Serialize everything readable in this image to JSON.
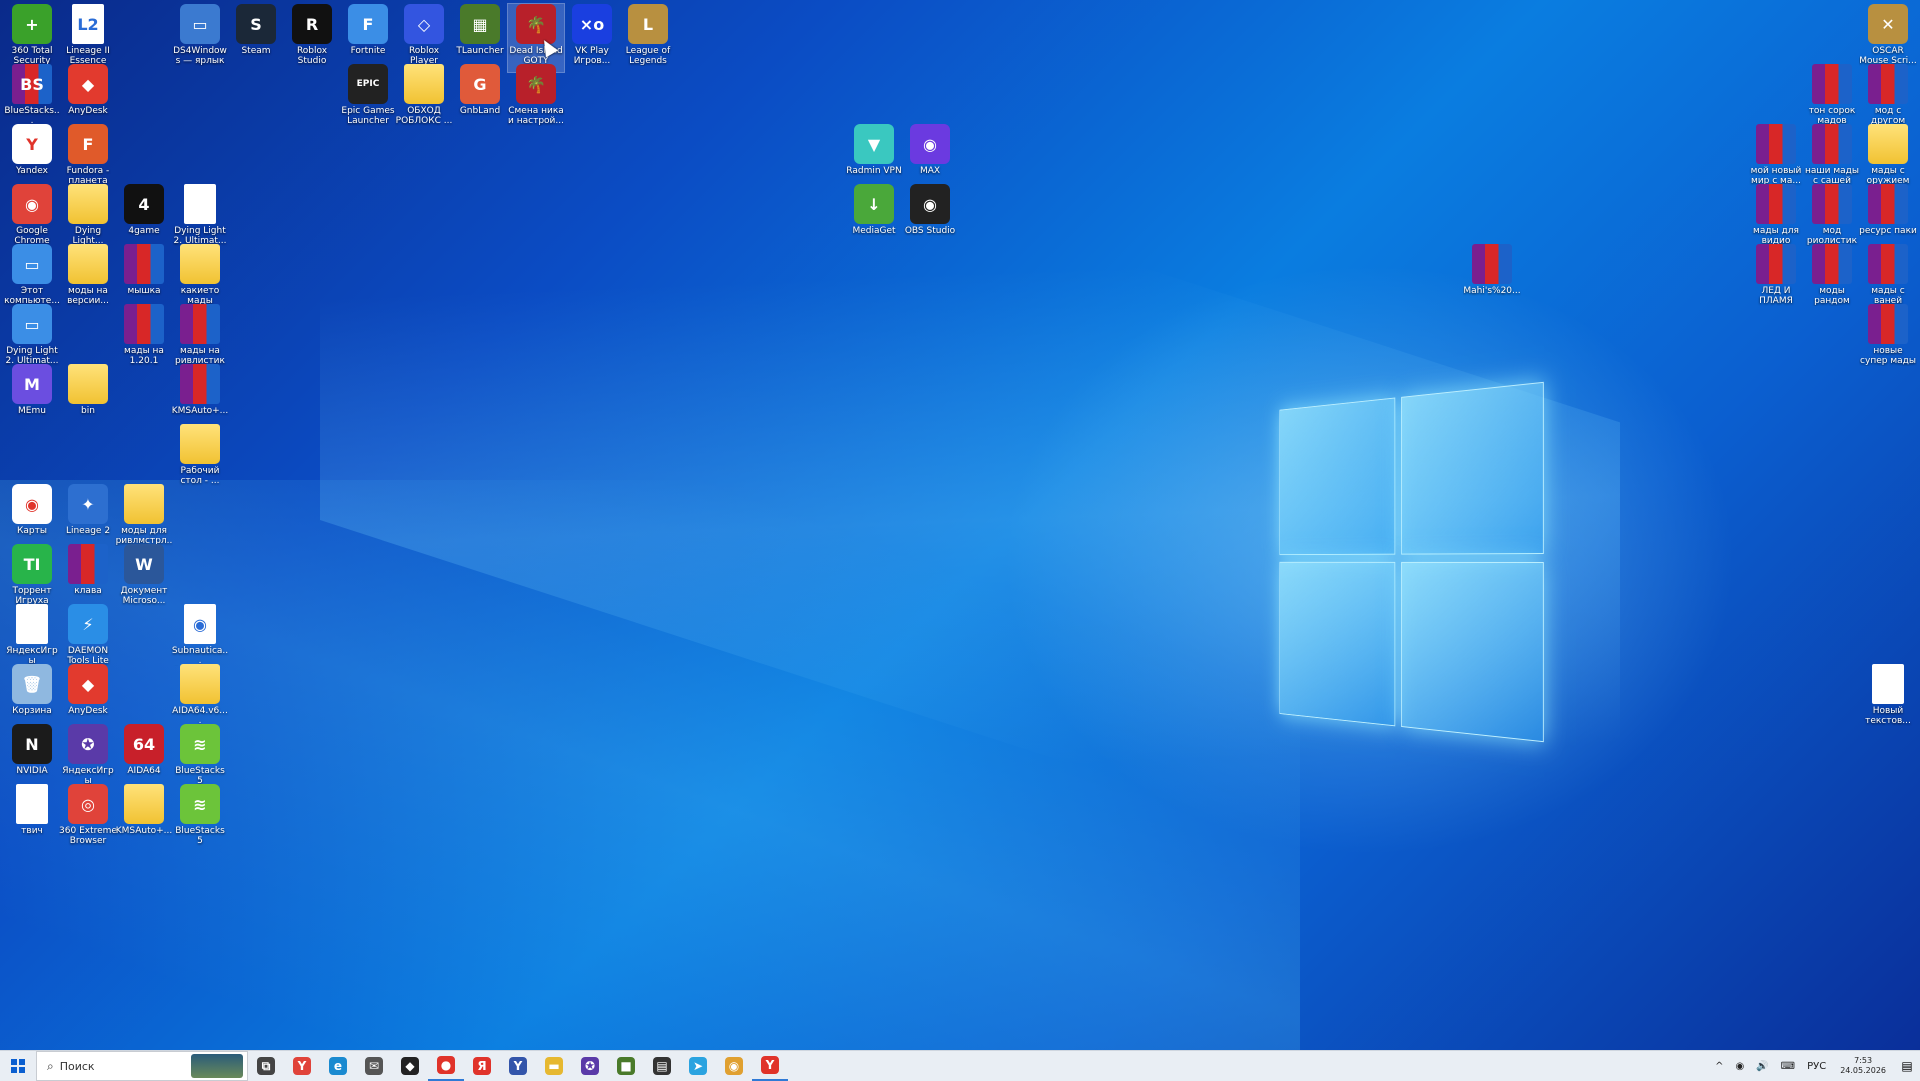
{
  "desktop": {
    "icons": [
      {
        "label": "360 Total Security",
        "glyph": "+",
        "color": "#3aa12a"
      },
      {
        "label": "Lineage II Essence",
        "glyph": "L2",
        "color": "#ffffff",
        "kind": "file"
      },
      {
        "label": "BlueStacks...",
        "glyph": "BS",
        "kind": "rar"
      },
      {
        "label": "AnyDesk",
        "glyph": "◆",
        "color": "#e23a2e"
      },
      {
        "label": "Yandex",
        "glyph": "Y",
        "color": "#ffffff"
      },
      {
        "label": "Fundora - планета игр",
        "glyph": "F",
        "color": "#e05a2a"
      },
      {
        "label": "Google Chrome",
        "glyph": "◉",
        "color": "#e0433a"
      },
      {
        "label": "Dying Light...",
        "glyph": "",
        "kind": "folder"
      },
      {
        "label": "4game",
        "glyph": "4",
        "color": "#111111"
      },
      {
        "label": "Dying Light 2. Ultimat...",
        "glyph": "",
        "kind": "file"
      },
      {
        "label": "Этот компьюте...",
        "glyph": "▭",
        "color": "#3b8ee6"
      },
      {
        "label": "моды на версии...",
        "glyph": "",
        "kind": "folder"
      },
      {
        "label": "мышка",
        "glyph": "",
        "kind": "rar"
      },
      {
        "label": "какието мады",
        "glyph": "",
        "kind": "folder"
      },
      {
        "label": "Dying Light 2. Ultimat...",
        "glyph": "▭",
        "color": "#3b8ee6"
      },
      {
        "label": "мады на 1.20.1",
        "glyph": "",
        "kind": "rar"
      },
      {
        "label": "мады на ривлистик",
        "glyph": "",
        "kind": "rar"
      },
      {
        "label": "MEmu",
        "glyph": "M",
        "color": "#6b4ee0"
      },
      {
        "label": "bin",
        "glyph": "",
        "kind": "folder"
      },
      {
        "label": "KMSAuto+...",
        "glyph": "",
        "kind": "rar"
      },
      {
        "label": "Рабочий стол - ...",
        "glyph": "",
        "kind": "folder"
      },
      {
        "label": "Карты",
        "glyph": "◉",
        "color": "#ffffff"
      },
      {
        "label": "Lineage 2",
        "glyph": "✦",
        "color": "#2d6fd0"
      },
      {
        "label": "моды для ривлмстрл...",
        "glyph": "",
        "kind": "folder"
      },
      {
        "label": "Торрент Игруха",
        "glyph": "TI",
        "color": "#28b44a"
      },
      {
        "label": "клава",
        "glyph": "",
        "kind": "rar"
      },
      {
        "label": "Документ Microso...",
        "glyph": "W",
        "color": "#2b579a"
      },
      {
        "label": "ЯндексИгры",
        "glyph": "",
        "kind": "file"
      },
      {
        "label": "DAEMON Tools Lite",
        "glyph": "⚡",
        "color": "#2a8ee6"
      },
      {
        "label": "Subnautica... AvailableT...",
        "glyph": "◉",
        "kind": "file"
      },
      {
        "label": "Корзина",
        "glyph": "🗑",
        "color": "#8fb8e0"
      },
      {
        "label": "AnyDesk",
        "glyph": "◆",
        "color": "#e23a2e"
      },
      {
        "label": "AIDA64.v6....",
        "glyph": "",
        "kind": "folder"
      },
      {
        "label": "NVIDIA",
        "glyph": "N",
        "color": "#1b1b1b"
      },
      {
        "label": "ЯндексИгры",
        "glyph": "✪",
        "color": "#5a3aa8"
      },
      {
        "label": "AIDA64",
        "glyph": "64",
        "color": "#c8202a"
      },
      {
        "label": "BlueStacks 5",
        "glyph": "≋",
        "color": "#6cc43a"
      },
      {
        "label": "твич",
        "glyph": "",
        "kind": "file"
      },
      {
        "label": "360 Extreme Browser",
        "glyph": "◎",
        "color": "#e0433a"
      },
      {
        "label": "KMSAuto+...",
        "glyph": "",
        "kind": "folder"
      },
      {
        "label": "BlueStacks 5",
        "glyph": "≋",
        "color": "#6cc43a"
      },
      {
        "label": "DS4Windows — ярлык",
        "glyph": "▭",
        "color": "#3b7ad0"
      },
      {
        "label": "Steam",
        "glyph": "S",
        "color": "#1b2838"
      },
      {
        "label": "Roblox Studio",
        "glyph": "R",
        "color": "#111111"
      },
      {
        "label": "Fortnite",
        "glyph": "F",
        "color": "#3b8ee6"
      },
      {
        "label": "Roblox Player",
        "glyph": "◇",
        "color": "#3355e0"
      },
      {
        "label": "TLauncher",
        "glyph": "▦",
        "color": "#4a7a2a"
      },
      {
        "label": "Dead Island GOTY",
        "glyph": "🌴",
        "color": "#b8202a"
      },
      {
        "label": "VK Play Игров...",
        "glyph": "×o",
        "color": "#1a3fe0"
      },
      {
        "label": "League of Legends",
        "glyph": "L",
        "color": "#b89040"
      },
      {
        "label": "Epic Games Launcher",
        "glyph": "EPIC",
        "color": "#222222"
      },
      {
        "label": "ОБХОД РОБЛОКС ...",
        "glyph": "",
        "kind": "folder"
      },
      {
        "label": "GnbLand",
        "glyph": "G",
        "color": "#e05a3a"
      },
      {
        "label": "Смена ника и настрой...",
        "glyph": "🌴",
        "color": "#b8202a"
      },
      {
        "label": "Radmin VPN",
        "glyph": "▼",
        "color": "#3ac8c0"
      },
      {
        "label": "MAX",
        "glyph": "◉",
        "color": "#6b3ae0"
      },
      {
        "label": "MediaGet",
        "glyph": "↓",
        "color": "#4aa83a"
      },
      {
        "label": "OBS Studio",
        "glyph": "◉",
        "color": "#222222"
      },
      {
        "label": "Mahi's%20...",
        "glyph": "",
        "kind": "rar"
      },
      {
        "label": "OSCAR Mouse Scri...",
        "glyph": "✕",
        "color": "#b89040"
      },
      {
        "label": "тон сорок мадов",
        "glyph": "",
        "kind": "rar"
      },
      {
        "label": "мод с другом",
        "glyph": "",
        "kind": "rar"
      },
      {
        "label": "мой новый мир с ма...",
        "glyph": "",
        "kind": "rar"
      },
      {
        "label": "наши мады с сашей",
        "glyph": "",
        "kind": "rar"
      },
      {
        "label": "мады с оружием",
        "glyph": "",
        "kind": "folder"
      },
      {
        "label": "мады для видио",
        "glyph": "",
        "kind": "rar"
      },
      {
        "label": "мод риолистик",
        "glyph": "",
        "kind": "rar"
      },
      {
        "label": "ресурс паки",
        "glyph": "",
        "kind": "rar"
      },
      {
        "label": "ЛЁД И ПЛАМЯ",
        "glyph": "",
        "kind": "rar"
      },
      {
        "label": "моды рандом",
        "glyph": "",
        "kind": "rar"
      },
      {
        "label": "мады с ваней",
        "glyph": "",
        "kind": "rar"
      },
      {
        "label": "новые супер мады с ору...",
        "glyph": "",
        "kind": "rar"
      },
      {
        "label": "Новый текстов...",
        "glyph": "",
        "kind": "file"
      }
    ]
  },
  "taskbar": {
    "search_placeholder": "Поиск",
    "pinned": [
      {
        "name": "task-view",
        "glyph": "⧉",
        "color": "#444444"
      },
      {
        "name": "yandex-browser",
        "glyph": "Y",
        "color": "#e0433a"
      },
      {
        "name": "edge",
        "glyph": "e",
        "color": "#1a8ad0"
      },
      {
        "name": "mail",
        "glyph": "✉",
        "color": "#555555"
      },
      {
        "name": "epic-games",
        "glyph": "◆",
        "color": "#222222"
      },
      {
        "name": "yandex-music",
        "glyph": "●",
        "color": "#e0332a"
      },
      {
        "name": "yandex",
        "glyph": "Я",
        "color": "#e0332a"
      },
      {
        "name": "yandex-app",
        "glyph": "Y",
        "color": "#3355aa"
      },
      {
        "name": "file-explorer",
        "glyph": "▬",
        "color": "#e6b830"
      },
      {
        "name": "yandex-games",
        "glyph": "✪",
        "color": "#5a3aa8"
      },
      {
        "name": "minecraft",
        "glyph": "■",
        "color": "#4a7a2a"
      },
      {
        "name": "terminal",
        "glyph": "▤",
        "color": "#333333"
      },
      {
        "name": "telegram",
        "glyph": "➤",
        "color": "#2aa3e0"
      },
      {
        "name": "chrome",
        "glyph": "◉",
        "color": "#e0a030"
      },
      {
        "name": "yandex-active",
        "glyph": "Y",
        "color": "#e0332a"
      }
    ],
    "tray": {
      "chevron": "^",
      "lang": "РУС",
      "time": "7:53",
      "date": "24.05.2026"
    }
  }
}
